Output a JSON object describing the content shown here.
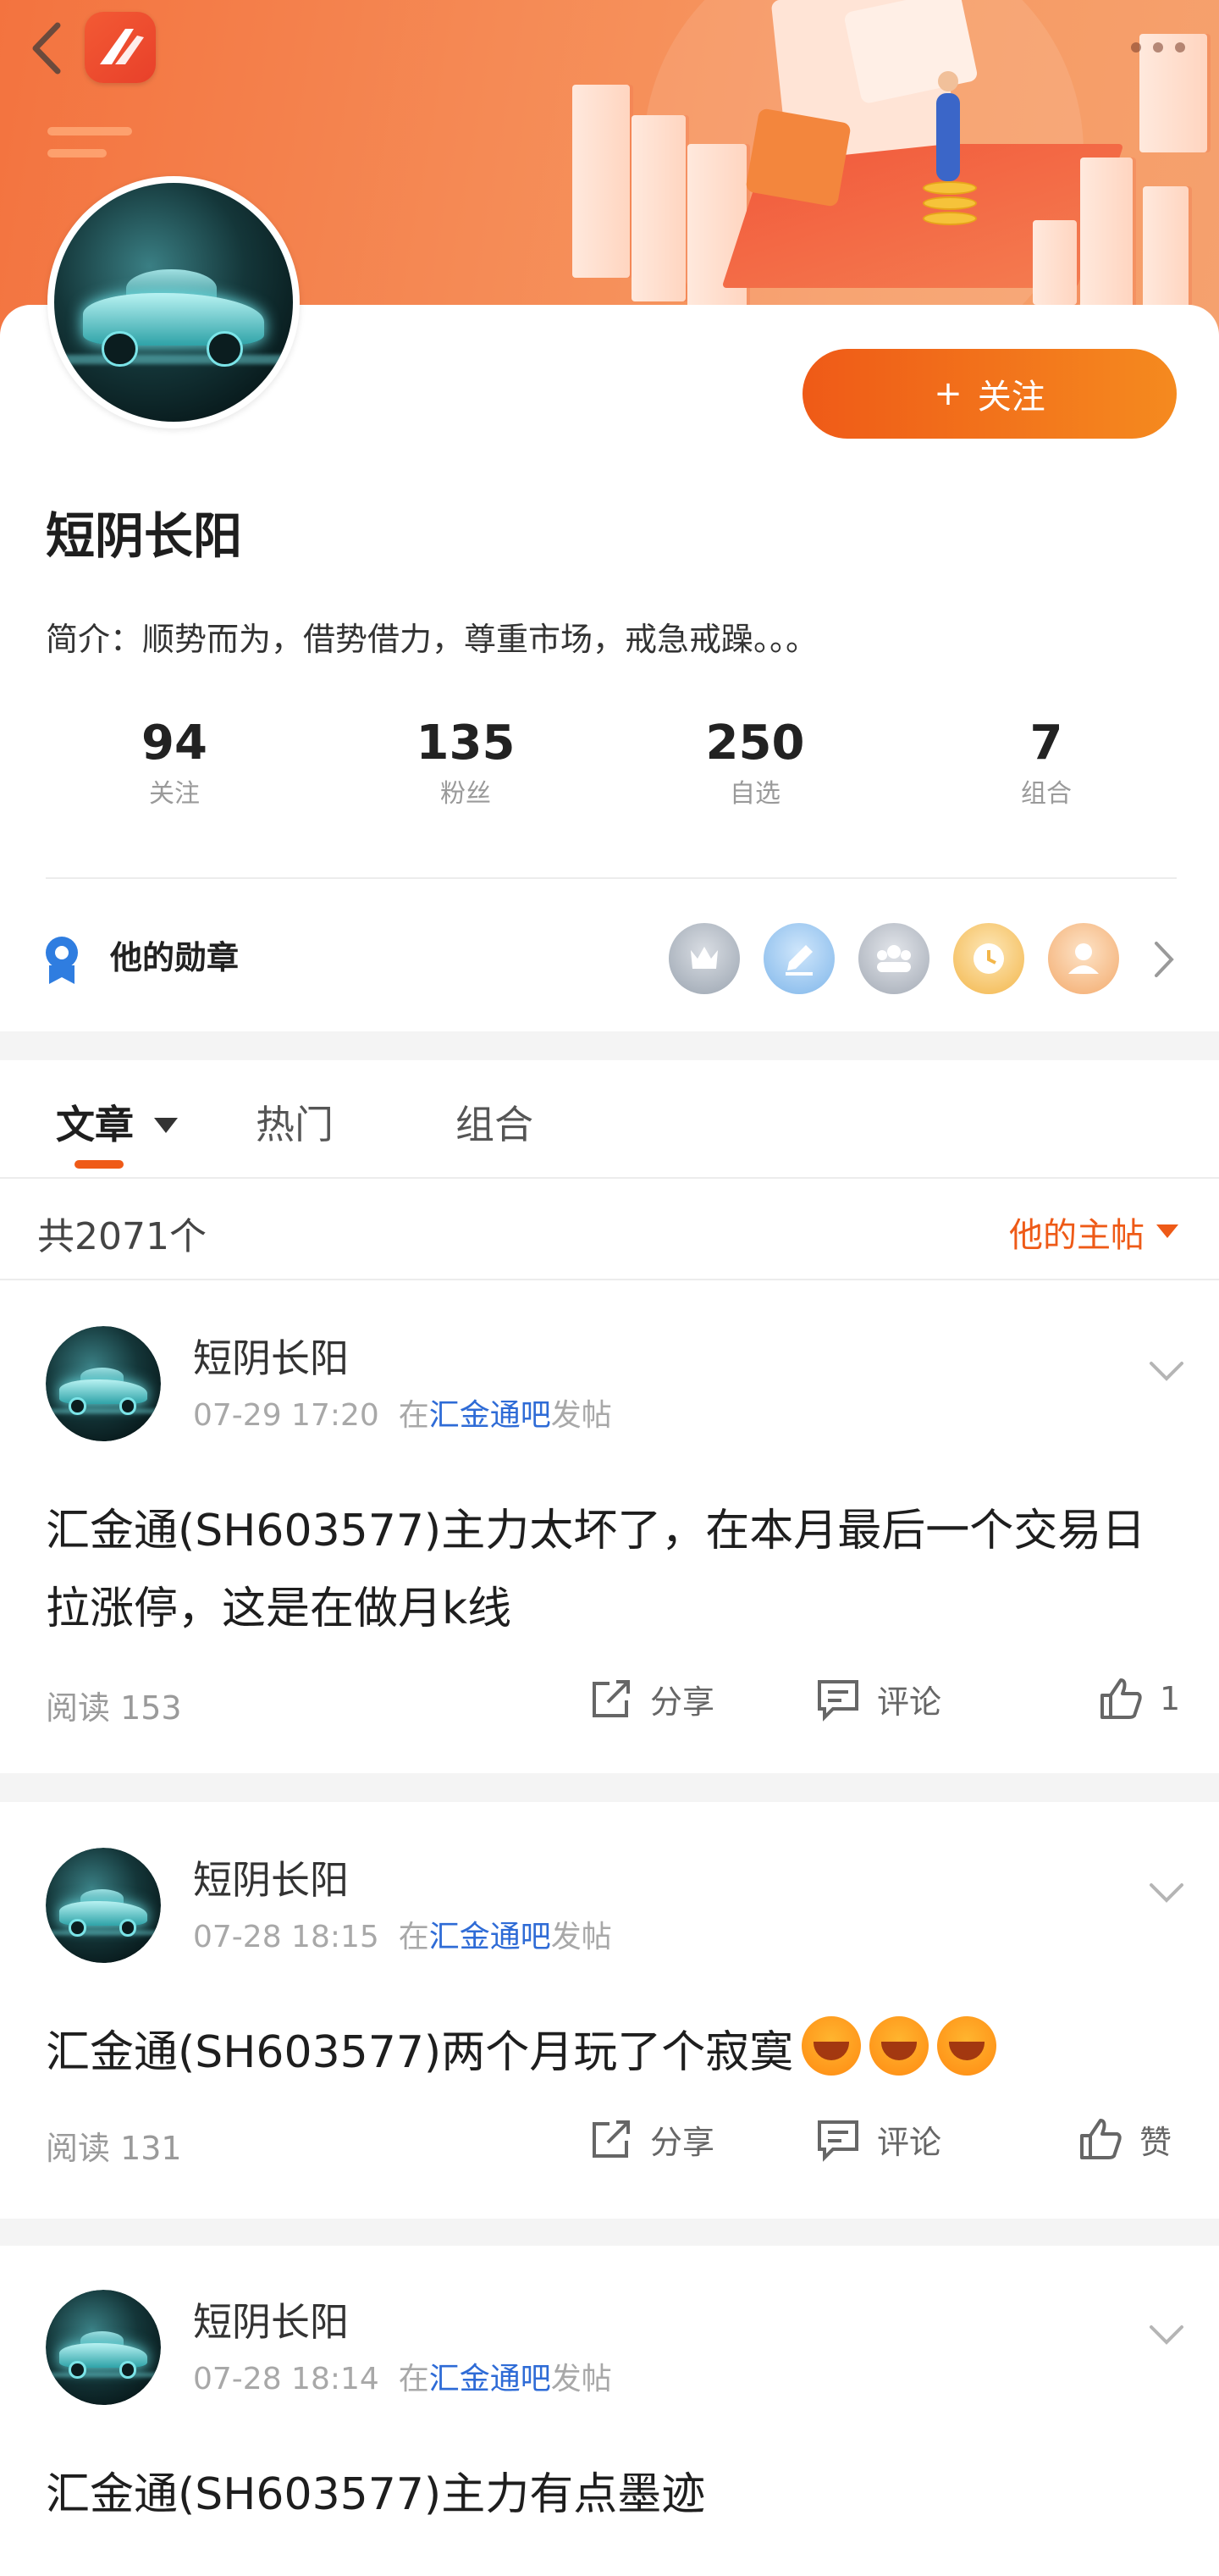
{
  "header": {
    "back_icon": "chevron-left-icon",
    "app_logo": "app-logo-icon",
    "more_icon": "more-dots-icon"
  },
  "profile": {
    "follow_label": "关注",
    "follow_icon": "+",
    "nickname": "短阴长阳",
    "bio": "简介：顺势而为，借势借力，尊重市场，戒急戒躁。。。",
    "stats": [
      {
        "value": "94",
        "label": "关注"
      },
      {
        "value": "135",
        "label": "粉丝"
      },
      {
        "value": "250",
        "label": "自选"
      },
      {
        "value": "7",
        "label": "组合"
      }
    ],
    "medals": {
      "title": "他的勋章",
      "items": [
        "crown-medal-icon",
        "pen-medal-icon",
        "group-medal-icon",
        "clock-medal-icon",
        "person-medal-icon"
      ]
    }
  },
  "tabs": {
    "items": [
      {
        "label": "文章"
      },
      {
        "label": "热门"
      },
      {
        "label": "组合"
      }
    ],
    "active": "文章"
  },
  "list": {
    "count": "共2071个",
    "filter": "他的主帖"
  },
  "posts": [
    {
      "author": "短阴长阳",
      "time": "07-29 17:20",
      "prefix": "在",
      "bar": "汇金通吧",
      "suffix": "发帖",
      "content": "汇金通(SH603577)主力太坏了，在本月最后一个交易日拉涨停，这是在做月k线",
      "read": "阅读 153",
      "share": "分享",
      "comment": "评论",
      "like": "1"
    },
    {
      "author": "短阴长阳",
      "time": "07-28 18:15",
      "prefix": "在",
      "bar": "汇金通吧",
      "suffix": "发帖",
      "content": "汇金通(SH603577)两个月玩了个寂寞",
      "read": "阅读 131",
      "share": "分享",
      "comment": "评论",
      "like": "赞"
    },
    {
      "author": "短阴长阳",
      "time": "07-28 18:14",
      "prefix": "在",
      "bar": "汇金通吧",
      "suffix": "发帖",
      "content": "汇金通(SH603577)主力有点墨迹"
    }
  ],
  "colors": {
    "accent": "#ef5a17",
    "link": "#2e6bd6",
    "banner": "#f3733f"
  }
}
